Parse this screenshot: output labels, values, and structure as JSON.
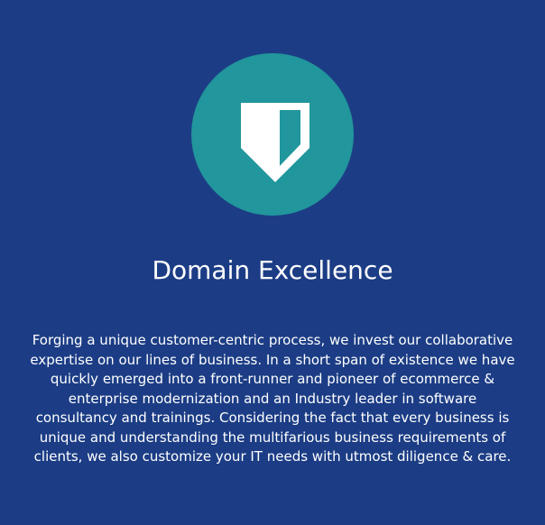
{
  "colors": {
    "background": "#1c3d85",
    "circle": "#21969c",
    "icon": "#ffffff",
    "text": "#ffffff"
  },
  "icon": {
    "name": "shield-icon"
  },
  "heading": {
    "title": "Domain Excellence"
  },
  "description": {
    "lines": [
      "Forging a unique customer-centric process, we invest our collaborative",
      "expertise on our lines of business. In a short span of existence we have",
      "quickly emerged into a front-runner and pioneer of ecommerce &",
      "enterprise modernization and an Industry leader in software",
      "consultancy and trainings. Considering the fact that every business is",
      "unique and understanding the multifarious business requirements of",
      "clients, we also customize your IT needs with utmost diligence & care."
    ]
  }
}
